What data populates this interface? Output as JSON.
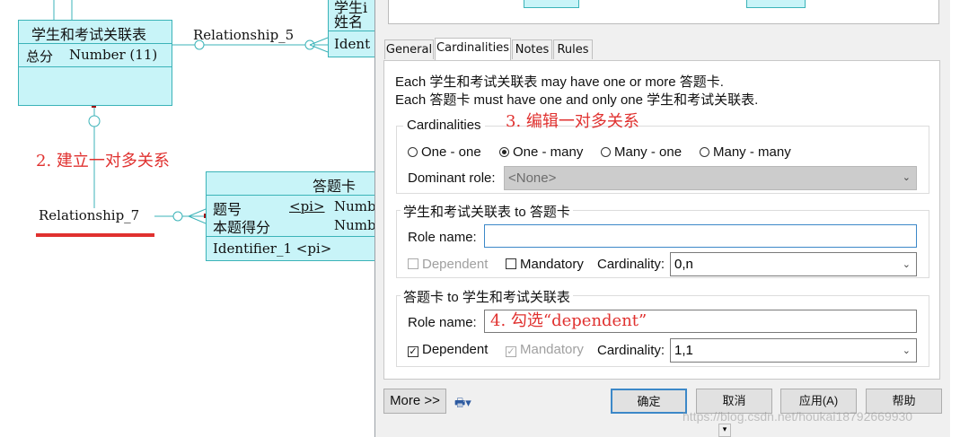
{
  "diagram": {
    "entity_main": {
      "title": "学生和考试关联表",
      "attr_name": "总分",
      "attr_type": "Number (11)"
    },
    "entity_top_right": {
      "line1": "学生i",
      "line2": "姓名",
      "line3": "Ident"
    },
    "entity_answer": {
      "title": "答题卡",
      "attr1_name": "题号",
      "attr1_key": "<pi>",
      "attr1_type": "Number",
      "attr2_name": "本题得分",
      "attr2_type": "Number",
      "identifier": "Identifier_1  <pi>"
    },
    "relationship_5": "Relationship_5",
    "relationship_7": "Relationship_7",
    "annotation_2": "2. 建立一对多关系",
    "annotation_3": "3. 编辑一对多关系",
    "annotation_4": "4. 勾选“dependent”",
    "accent_red": "#e0312f",
    "entity_fill": "#c8f4f8"
  },
  "dialog": {
    "tabs": [
      "General",
      "Cardinalities",
      "Notes",
      "Rules"
    ],
    "active_tab": "Cardinalities",
    "desc1": "Each 学生和考试关联表 may have one or more 答题卡.",
    "desc2": "Each 答题卡 must have one and only one 学生和考试关联表.",
    "cardinalities": {
      "group_label": "Cardinalities",
      "options": [
        "One - one",
        "One - many",
        "Many - one",
        "Many - many"
      ],
      "selected": "One - many",
      "dominant_role_label": "Dominant role:",
      "dominant_role_value": "<None>"
    },
    "role1": {
      "group_label": "学生和考试关联表 to 答题卡",
      "role_name_label": "Role name:",
      "role_name_value": "",
      "dependent_label": "Dependent",
      "dependent_checked": false,
      "mandatory_label": "Mandatory",
      "mandatory_checked": false,
      "cardinality_label": "Cardinality:",
      "cardinality_value": "0,n"
    },
    "role2": {
      "group_label": "答题卡 to 学生和考试关联表",
      "role_name_label": "Role name:",
      "role_name_value": "",
      "dependent_label": "Dependent",
      "dependent_checked": true,
      "mandatory_label": "Mandatory",
      "mandatory_checked": true,
      "cardinality_label": "Cardinality:",
      "cardinality_value": "1,1"
    },
    "buttons": {
      "more": "More >>",
      "ok": "确定",
      "cancel": "取消",
      "apply": "应用(A)",
      "help": "帮助"
    },
    "watermark": "https://blog.csdn.net/houkai18792669930"
  }
}
